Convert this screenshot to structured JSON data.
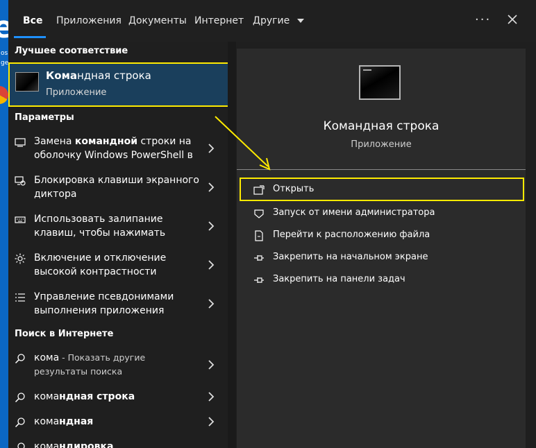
{
  "desktop": {
    "icon_texts": [
      "os",
      "ge"
    ]
  },
  "tabs": [
    {
      "label": "Все",
      "active": true
    },
    {
      "label": "Приложения"
    },
    {
      "label": "Документы"
    },
    {
      "label": "Интернет"
    },
    {
      "label": "Другие"
    }
  ],
  "topbar": {
    "more_label": "···"
  },
  "best_match": {
    "section_title": "Лучшее соответствие",
    "name_bold": "Кома",
    "name_rest": "ндная строка",
    "subtitle": "Приложение"
  },
  "settings": {
    "section_title": "Параметры",
    "items": [
      {
        "pre": "Замена ",
        "bold": "командной",
        "post": " строки на оболочку Windows PowerShell в",
        "icon": "monitor-icon"
      },
      {
        "pre": "Блокировка клавиши экранного диктора",
        "bold": "",
        "post": "",
        "icon": "narrator-icon"
      },
      {
        "pre": "Использовать залипание клавиш, чтобы нажимать",
        "bold": "",
        "post": "",
        "icon": "keyboard-icon"
      },
      {
        "pre": "Включение и отключение высокой контрастности",
        "bold": "",
        "post": "",
        "icon": "brightness-icon"
      },
      {
        "pre": "Управление псевдонимами выполнения приложения",
        "bold": "",
        "post": "",
        "icon": "list-icon"
      }
    ]
  },
  "web": {
    "section_title": "Поиск в Интернете",
    "items": [
      {
        "pre": "кома",
        "bold": "",
        "hint": " - Показать другие результаты поиска"
      },
      {
        "pre": "кома",
        "bold": "ндная строка",
        "hint": ""
      },
      {
        "pre": "кома",
        "bold": "ндная",
        "hint": ""
      },
      {
        "pre": "кома",
        "bold": "ндировка",
        "hint": ""
      }
    ]
  },
  "detail": {
    "title": "Командная строка",
    "subtitle": "Приложение",
    "actions": [
      {
        "label": "Открыть",
        "icon": "open-window-icon"
      },
      {
        "label": "Запуск от имени администратора",
        "icon": "shield-icon"
      },
      {
        "label": "Перейти к расположению файла",
        "icon": "file-location-icon"
      },
      {
        "label": "Закрепить на начальном экране",
        "icon": "pin-icon"
      },
      {
        "label": "Закрепить на панели задач",
        "icon": "pin-icon"
      }
    ]
  },
  "colors": {
    "highlight": "#ffeb00",
    "accent": "#1e90ff",
    "selected_bg": "#1a3f5c"
  }
}
